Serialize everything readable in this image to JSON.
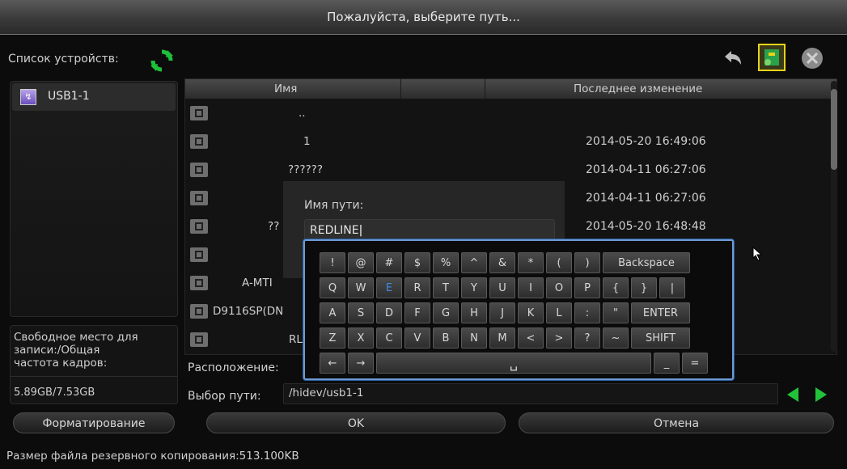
{
  "title": "Пожалуйста, выберите путь...",
  "device_list_label": "Список устройств:",
  "devices": [
    {
      "name": "USB1-1"
    }
  ],
  "free_space": {
    "label_lines": [
      "Свободное место для",
      "записи:/Общая",
      "частота кадров:"
    ],
    "value": "5.89GB/7.53GB"
  },
  "file_table": {
    "col_name": "Имя",
    "col_modified": "Последнее изменение",
    "rows": [
      {
        "name": "..",
        "date": ""
      },
      {
        "name": "1",
        "date": "2014-05-20 16:49:06"
      },
      {
        "name": "??????",
        "date": "2014-04-11 06:27:06"
      },
      {
        "name": "",
        "date": "2014-04-11 06:27:06"
      },
      {
        "name": "??",
        "date": "2014-05-20 16:48:48"
      },
      {
        "name": "",
        "date": ""
      },
      {
        "name": "A-MTI",
        "date": ""
      },
      {
        "name": "D9116SP(DN",
        "date": ""
      },
      {
        "name": "RL",
        "date": ""
      }
    ]
  },
  "dialog": {
    "label": "Имя пути:",
    "value": "REDLINE"
  },
  "keyboard": {
    "row1": [
      "!",
      "@",
      "#",
      "$",
      "%",
      "^",
      "&",
      "*",
      "(",
      ")",
      "Backspace"
    ],
    "row2": [
      "Q",
      "W",
      "E",
      "R",
      "T",
      "Y",
      "U",
      "I",
      "O",
      "P",
      "{",
      "}",
      "|"
    ],
    "row3": [
      "A",
      "S",
      "D",
      "F",
      "G",
      "H",
      "J",
      "K",
      "L",
      ":",
      "\"",
      "ENTER"
    ],
    "row4": [
      "Z",
      "X",
      "C",
      "V",
      "B",
      "N",
      "M",
      "<",
      ">",
      "?",
      "~",
      "SHIFT"
    ],
    "row5": [
      "←",
      "→",
      "␣",
      "_",
      "="
    ],
    "highlighted": "E"
  },
  "location_label": "Расположение:",
  "path_label": "Выбор пути:",
  "path_value": "/hidev/usb1-1",
  "buttons": {
    "format": "Форматирование",
    "ok": "OK",
    "cancel": "Отмена"
  },
  "status_text": "Размер файла резервного копирования:513.100KB",
  "colors": {
    "accent_green": "#22c23a",
    "kbd_border": "#6d9ad3",
    "highlight_key": "#3c8be0"
  }
}
